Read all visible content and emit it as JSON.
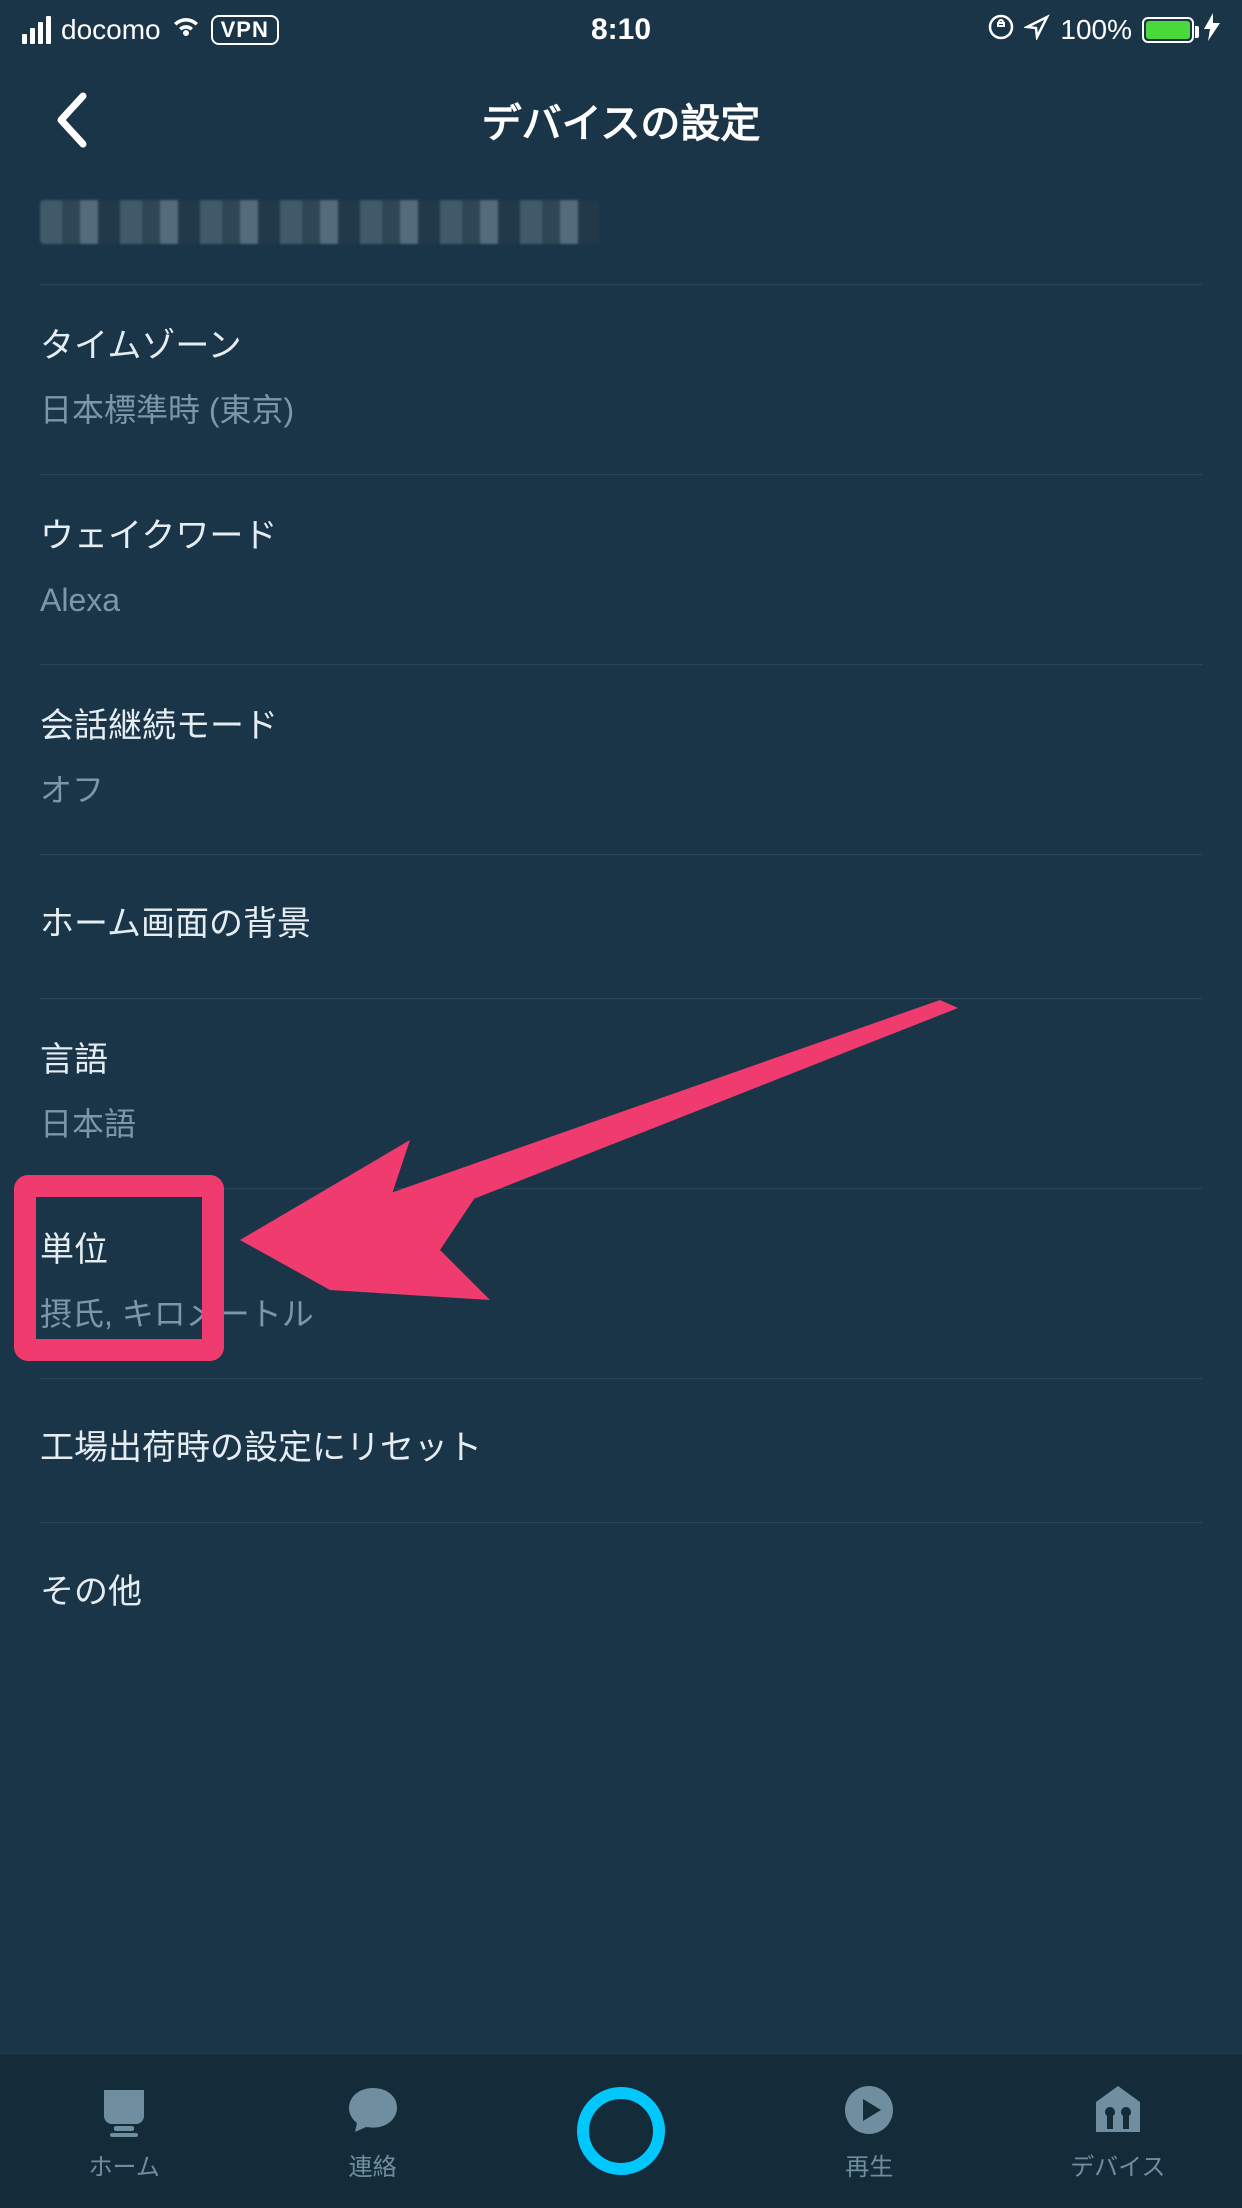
{
  "status": {
    "carrier": "docomo",
    "vpn": "VPN",
    "time": "8:10",
    "battery_pct": "100%"
  },
  "nav": {
    "title": "デバイスの設定"
  },
  "rows": {
    "timezone": {
      "label": "タイムゾーン",
      "value": "日本標準時 (東京)"
    },
    "wakeword": {
      "label": "ウェイクワード",
      "value": "Alexa"
    },
    "followup": {
      "label": "会話継続モード",
      "value": "オフ"
    },
    "homebg": {
      "label": "ホーム画面の背景"
    },
    "language": {
      "label": "言語",
      "value": "日本語"
    },
    "units": {
      "label": "単位",
      "value": "摂氏, キロメートル"
    },
    "reset": {
      "label": "工場出荷時の設定にリセット"
    },
    "other": {
      "label": "その他"
    }
  },
  "tabs": {
    "home": "ホーム",
    "contact": "連絡",
    "play": "再生",
    "device": "デバイス"
  }
}
